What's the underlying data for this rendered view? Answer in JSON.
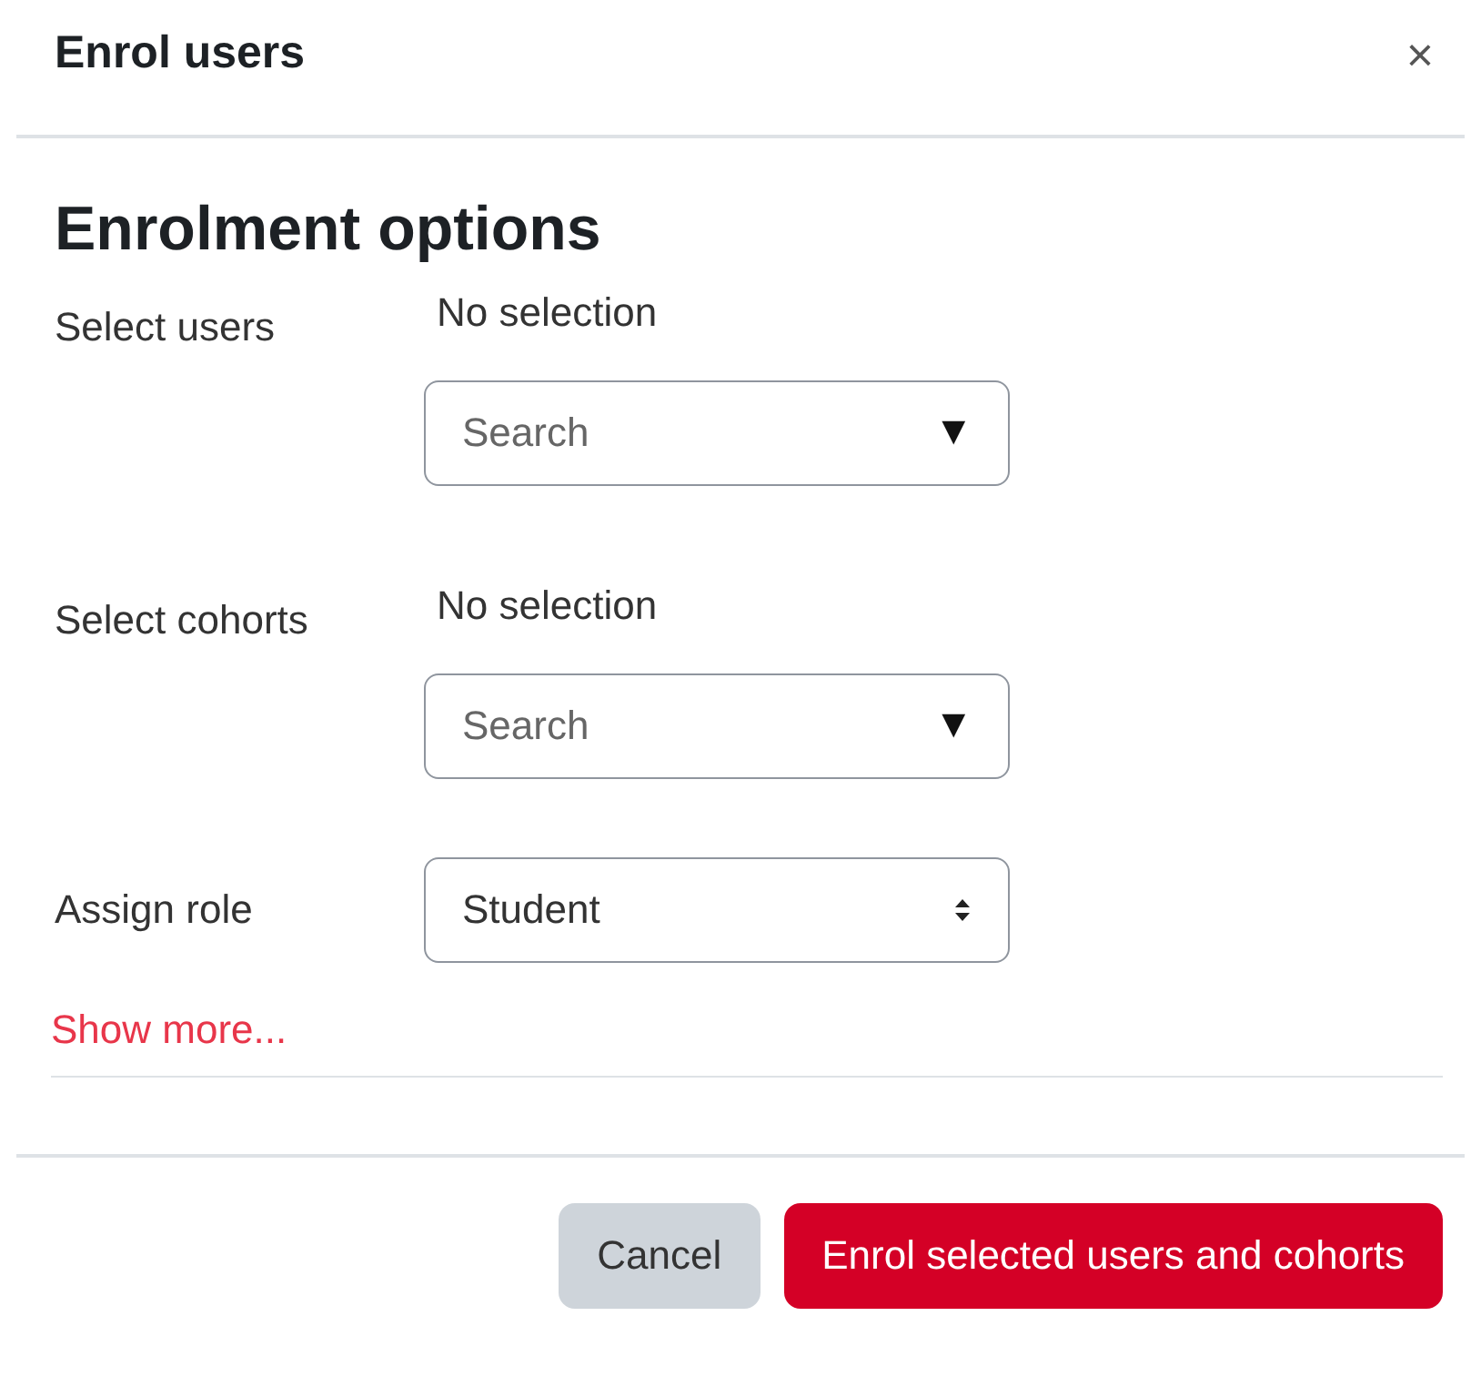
{
  "dialog": {
    "title": "Enrol users",
    "close": "×"
  },
  "heading": "Enrolment options",
  "fields": [
    {
      "kind": "autocomplete",
      "label": "Select users",
      "selection": "No selection",
      "placeholder": "Search",
      "arrow": "▼"
    },
    {
      "kind": "autocomplete",
      "label": "Select cohorts",
      "selection": "No selection",
      "placeholder": "Search",
      "arrow": "▼"
    },
    {
      "kind": "select",
      "label": "Assign role",
      "value": "Student"
    }
  ],
  "show_more": "Show more...",
  "buttons": [
    {
      "label": "Cancel",
      "kind": "secondary"
    },
    {
      "label": "Enrol selected users and cohorts",
      "kind": "primary"
    }
  ]
}
